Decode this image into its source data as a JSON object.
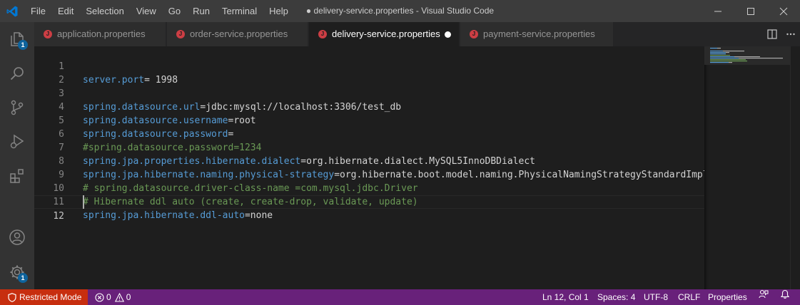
{
  "titlebar": {
    "menu": [
      "File",
      "Edit",
      "Selection",
      "View",
      "Go",
      "Run",
      "Terminal",
      "Help"
    ],
    "title": "● delivery-service.properties - Visual Studio Code"
  },
  "activity": {
    "explorer_badge": "1",
    "settings_badge": "1"
  },
  "tabs": [
    {
      "label": "application.properties",
      "icon": "J",
      "active": false
    },
    {
      "label": "order-service.properties",
      "icon": "J",
      "active": false
    },
    {
      "label": "delivery-service.properties",
      "icon": "J",
      "active": true,
      "dirty": true
    },
    {
      "label": "payment-service.properties",
      "icon": "J",
      "active": false
    }
  ],
  "editor": {
    "lines": [
      {
        "n": "1",
        "key": "server.port",
        "val": "= 1998"
      },
      {
        "n": "2"
      },
      {
        "n": "3",
        "key": "spring.datasource.url",
        "val": "=jdbc:mysql://localhost:3306/test_db"
      },
      {
        "n": "4",
        "key": "spring.datasource.username",
        "val": "=root"
      },
      {
        "n": "5",
        "key": "spring.datasource.password",
        "val": "="
      },
      {
        "n": "6",
        "comment": "#spring.datasource.password=1234"
      },
      {
        "n": "7",
        "key": "spring.jpa.properties.hibernate.dialect",
        "val": "=org.hibernate.dialect.MySQL5InnoDBDialect"
      },
      {
        "n": "8",
        "key": "spring.jpa.hibernate.naming.physical-strategy",
        "val": "=org.hibernate.boot.model.naming.PhysicalNamingStrategyStandardImpl"
      },
      {
        "n": "9",
        "comment": "# spring.datasource.driver-class-name =com.mysql.jdbc.Driver"
      },
      {
        "n": "10",
        "comment": "# Hibernate ddl auto (create, create-drop, validate, update)"
      },
      {
        "n": "11",
        "key": "spring.jpa.hibernate.ddl-auto",
        "val": "=none"
      },
      {
        "n": "12",
        "current": true
      }
    ]
  },
  "status": {
    "restricted": "Restricted Mode",
    "errors": "0",
    "warnings": "0",
    "position": "Ln 12, Col 1",
    "spaces": "Spaces: 4",
    "encoding": "UTF-8",
    "eol": "CRLF",
    "language": "Properties"
  },
  "colors": {
    "statusbar": "#68217a",
    "restricted": "#c72e0f",
    "key": "#569cd6",
    "comment": "#6a9955"
  }
}
